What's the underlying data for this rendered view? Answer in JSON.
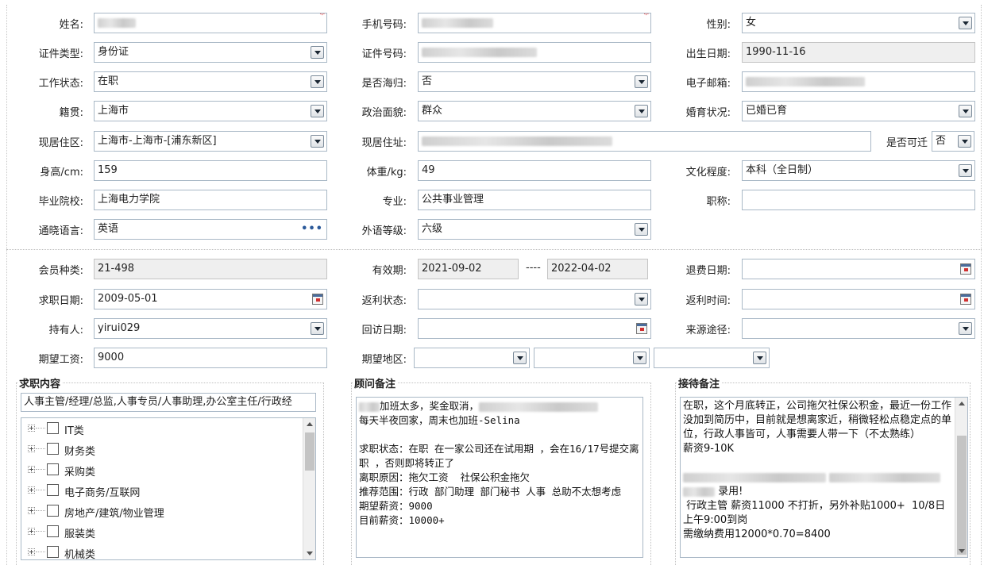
{
  "basic": {
    "name_label": "姓名:",
    "phone_label": "手机号码:",
    "gender_label": "性别:",
    "gender_value": "女",
    "id_type_label": "证件类型:",
    "id_type_value": "身份证",
    "id_no_label": "证件号码:",
    "birth_label": "出生日期:",
    "birth_value": "1990-11-16",
    "work_status_label": "工作状态:",
    "work_status_value": "在职",
    "overseas_label": "是否海归:",
    "overseas_value": "否",
    "email_label": "电子邮箱:",
    "native_label": "籍贯:",
    "native_value": "上海市",
    "politics_label": "政治面貌:",
    "politics_value": "群众",
    "marital_label": "婚育状况:",
    "marital_value": "已婚已育",
    "residence_label": "现居住区:",
    "residence_value": "上海市-上海市-[浦东新区]",
    "address_label": "现居住址:",
    "relocate_label": "是否可迁",
    "relocate_value": "否",
    "height_label": "身高/cm:",
    "height_value": "159",
    "weight_label": "体重/kg:",
    "weight_value": "49",
    "education_label": "文化程度:",
    "education_value": "本科（全日制）",
    "school_label": "毕业院校:",
    "school_value": "上海电力学院",
    "major_label": "专业:",
    "major_value": "公共事业管理",
    "title_label": "职称:",
    "language_label": "通晓语言:",
    "language_value": "英语",
    "language_more": "•••",
    "lang_level_label": "外语等级:",
    "lang_level_value": "六级"
  },
  "member": {
    "type_label": "会员种类:",
    "type_value": "21-498",
    "valid_label": "有效期:",
    "valid_from": "2021-09-02",
    "valid_sep": "----",
    "valid_to": "2022-04-02",
    "refund_label": "退费日期:",
    "jobdate_label": "求职日期:",
    "jobdate_value": "2009-05-01",
    "rebate_status_label": "返利状态:",
    "rebate_time_label": "返利时间:",
    "holder_label": "持有人:",
    "holder_value": "yirui029",
    "visit_label": "回访日期:",
    "source_label": "来源途径:",
    "salary_label": "期望工资:",
    "salary_value": "9000",
    "area_label": "期望地区:"
  },
  "job_panel": {
    "title": "求职内容",
    "selected": "人事主管/经理/总监,人事专员/人事助理,办公室主任/行政经",
    "tree": [
      "IT类",
      "财务类",
      "采购类",
      "电子商务/互联网",
      "房地产/建筑/物业管理",
      "服装类",
      "机械类"
    ]
  },
  "advisor_panel": {
    "title": "顾问备注",
    "line1_suffix": "加班太多，奖金取消，",
    "text": "每天半夜回家，周末也加班-Selina\n\n求职状态：在职 在一家公司还在试用期 ，会在16/17号提交离职 ，否则即将转正了\n离职原因：拖欠工资  社保公积金拖欠\n推荐范围：行政 部门助理 部门秘书 人事 总助不太想考虑\n期望薪资：9000\n目前薪资：10000+"
  },
  "reception_panel": {
    "title": "接待备注",
    "text_top": "在职，这个月底转正，公司拖欠社保公积金，最近一份工作没加到简历中，目前就是想离家近，稍微轻松点稳定点的单位，行政人事皆可，人事需要人带一下（不太熟练）\n薪资9-10K",
    "hired": "录用!",
    "text_bottom": " 行政主管 薪资11000 不打折，另外补贴1000+  10/8日上午9:00到岗\n需缴纳费用12000*0.70=8400"
  }
}
